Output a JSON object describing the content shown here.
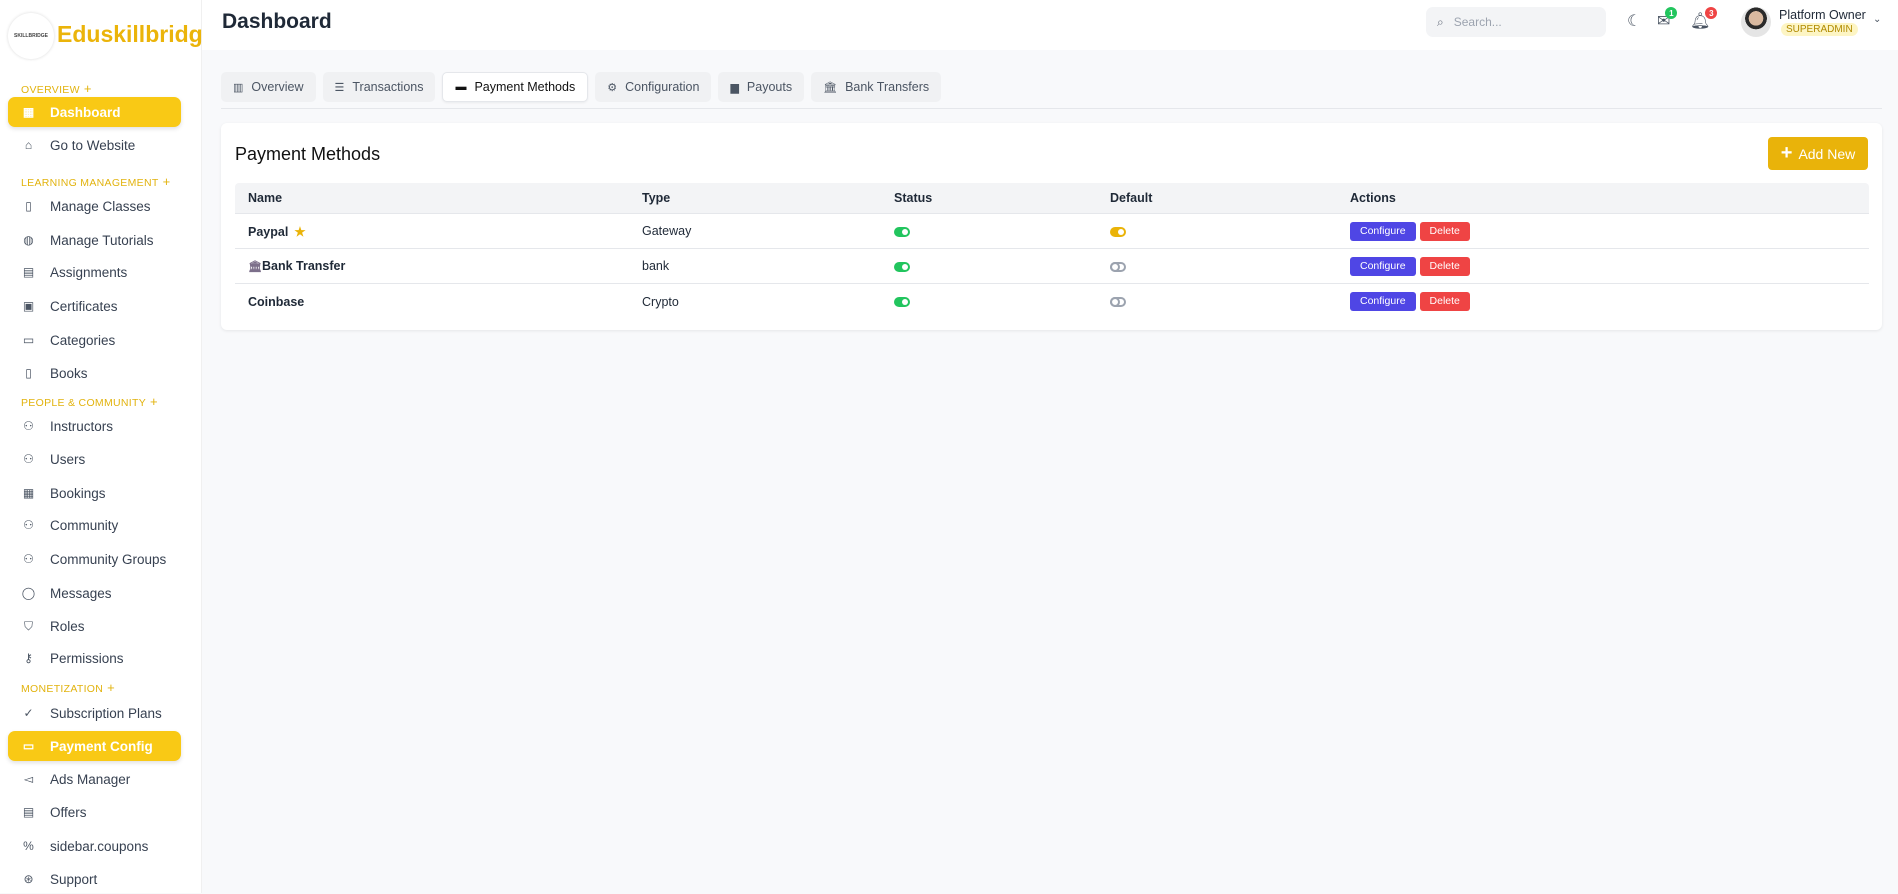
{
  "brand": {
    "name": "Eduskillbridge",
    "logo_text": "SKILLBRIDGE"
  },
  "header": {
    "title": "Dashboard",
    "search_placeholder": "Search...",
    "mail_count": "1",
    "notif_count": "3",
    "user_name": "Platform Owner",
    "user_role": "SUPERADMIN"
  },
  "sidebar": {
    "sections": {
      "overview": "OVERVIEW",
      "learning": "LEARNING MANAGEMENT",
      "people": "PEOPLE & COMMUNITY",
      "monetization": "MONETIZATION"
    },
    "items": [
      {
        "label": "Dashboard"
      },
      {
        "label": "Go to Website"
      },
      {
        "label": "Manage Classes"
      },
      {
        "label": "Manage Tutorials"
      },
      {
        "label": "Assignments"
      },
      {
        "label": "Certificates"
      },
      {
        "label": "Categories"
      },
      {
        "label": "Books"
      },
      {
        "label": "Instructors"
      },
      {
        "label": "Users"
      },
      {
        "label": "Bookings"
      },
      {
        "label": "Community"
      },
      {
        "label": "Community Groups"
      },
      {
        "label": "Messages"
      },
      {
        "label": "Roles"
      },
      {
        "label": "Permissions"
      },
      {
        "label": "Subscription Plans"
      },
      {
        "label": "Payment Config"
      },
      {
        "label": "Ads Manager"
      },
      {
        "label": "Offers"
      },
      {
        "label": "sidebar.coupons"
      },
      {
        "label": "Support"
      }
    ]
  },
  "tabs": [
    {
      "label": "Overview"
    },
    {
      "label": "Transactions"
    },
    {
      "label": "Payment Methods"
    },
    {
      "label": "Configuration"
    },
    {
      "label": "Payouts"
    },
    {
      "label": "Bank Transfers"
    }
  ],
  "card": {
    "title": "Payment Methods",
    "add_label": "Add New",
    "columns": [
      "Name",
      "Type",
      "Status",
      "Default",
      "Actions"
    ],
    "rows": [
      {
        "name": "Paypal",
        "type": "Gateway",
        "status": true,
        "default": true
      },
      {
        "name": "Bank Transfer",
        "type": "bank",
        "status": true,
        "default": false
      },
      {
        "name": "Coinbase",
        "type": "Crypto",
        "status": true,
        "default": false
      }
    ],
    "configure_label": "Configure",
    "delete_label": "Delete"
  },
  "colors": {
    "accent": "#f9c915",
    "add_button": "#e9b30a",
    "configure": "#4f46e5",
    "delete": "#ef4444",
    "toggle_on": "#22c55e"
  }
}
